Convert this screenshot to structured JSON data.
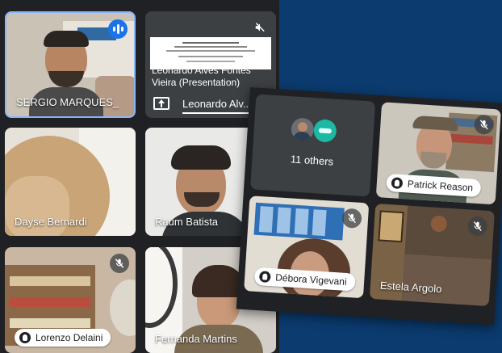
{
  "grid_a": {
    "tiles": [
      {
        "name": "SERGIO MARQUES_"
      },
      {
        "name": "Leonardo Alves Fontes Vieira (Presentation)",
        "footer": "Leonardo Alv..."
      },
      {
        "name": "Dayse Bernardi"
      },
      {
        "name": "Raum Batista"
      },
      {
        "name": "Lorenzo Delaini"
      },
      {
        "name": "Fernanda Martins"
      }
    ]
  },
  "grid_b": {
    "others_label": "11 others",
    "tiles": [
      {
        "name": "Patrick Reason"
      },
      {
        "name": "Débora Vigevani"
      },
      {
        "name": "Estela Argolo"
      }
    ]
  },
  "colors": {
    "background": "#0b3b6f",
    "speaking": "#1a73e8",
    "tile": "#3c4043",
    "others_avatar": "#1db9a5"
  }
}
